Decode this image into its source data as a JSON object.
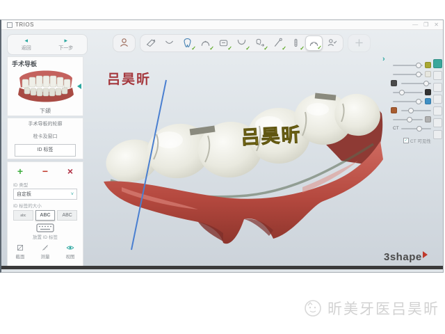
{
  "window": {
    "title": "TRIOS",
    "minimize": "—",
    "maximize": "❐",
    "close": "✕"
  },
  "nav": {
    "back_label": "返回",
    "next_label": "下一步",
    "back_arrow": "◂",
    "next_arrow": "▸"
  },
  "toolbar": {
    "check_glyph": "✓",
    "lead": [
      {
        "icon": "patient-icon",
        "checked": false,
        "active": false
      }
    ],
    "steps": [
      {
        "icon": "scan-icon",
        "checked": false,
        "active": false
      },
      {
        "icon": "smile-icon",
        "checked": false,
        "active": false
      },
      {
        "icon": "tooth-design-icon",
        "checked": true,
        "active": false
      },
      {
        "icon": "arch-icon",
        "checked": true,
        "active": false
      },
      {
        "icon": "model-icon",
        "checked": true,
        "active": false
      },
      {
        "icon": "u-arch-icon",
        "checked": true,
        "active": false
      },
      {
        "icon": "tooth-flow-icon",
        "checked": true,
        "active": false
      },
      {
        "icon": "probe-icon",
        "checked": true,
        "active": false
      },
      {
        "icon": "implant-icon",
        "checked": true,
        "active": false
      },
      {
        "icon": "guide-icon",
        "checked": true,
        "active": true
      },
      {
        "icon": "order-icon",
        "checked": false,
        "active": false
      }
    ],
    "trail": [
      {
        "icon": "export-icon",
        "checked": false,
        "active": false
      }
    ]
  },
  "sidebar": {
    "title": "手术导板",
    "jaw_label": "下颌",
    "menu_items": [
      {
        "label": "手术导板的轮廓",
        "selected": false
      },
      {
        "label": "栓卡及窗口",
        "selected": false
      },
      {
        "label": "ID 标签",
        "selected": true
      }
    ],
    "id_buttons": {
      "add": "+",
      "remove": "−",
      "close": "×"
    },
    "type_label": "ID 类型",
    "type_value": "自定板",
    "type_chevron": "˅",
    "size_label": "ID 标签的大小",
    "size_options": [
      {
        "label": "abc",
        "selected": false,
        "small": true
      },
      {
        "label": "ABC",
        "selected": true,
        "small": false
      },
      {
        "label": "ABC",
        "selected": false,
        "small": false
      }
    ],
    "stamp_label": "放置 ID 标签",
    "view_tools": [
      {
        "icon": "section-icon",
        "label": "截面"
      },
      {
        "icon": "measure-icon",
        "label": "测量"
      },
      {
        "icon": "eye-icon",
        "label": "视图"
      }
    ]
  },
  "viewport": {
    "annotation_red": "吕昊昕",
    "annotation_gold": "吕昊昕",
    "brand": "3shape",
    "colors": {
      "gum": "#b5493f",
      "tooth": "#ecece4",
      "axis_line": "#4a7fd0",
      "gold_text": "#d2bf2e",
      "red_text": "#a5383d"
    }
  },
  "right_panel": {
    "collapse_chevron": "›",
    "ct_checkbox_label": "CT 可见性",
    "ct_check_glyph": "✓",
    "sliders": [
      {
        "chip": "#a8a832",
        "right": true,
        "pos": "86%",
        "label": ""
      },
      {
        "chip": "#e6e6de",
        "right": true,
        "pos": "86%",
        "label": ""
      },
      {
        "chip": "#4a4a4a",
        "right": false,
        "pos": "84%",
        "label": ""
      },
      {
        "chip": "#333333",
        "right": true,
        "pos": "30%",
        "label": ""
      },
      {
        "chip": "#3f8fc4",
        "right": true,
        "pos": "86%",
        "label": ""
      },
      {
        "chip": "#a85c30",
        "right": false,
        "pos": "32%",
        "label": ""
      },
      {
        "chip": "#b0b0b0",
        "right": true,
        "pos": "55%",
        "label": ""
      },
      {
        "chip": null,
        "hidden_chip": true,
        "right": false,
        "pos": "60%",
        "label": "CT"
      }
    ],
    "view_icons": [
      {
        "active": true
      },
      {
        "active": false
      },
      {
        "active": false
      },
      {
        "active": false
      },
      {
        "active": false
      },
      {
        "active": false
      },
      {
        "active": false
      }
    ]
  },
  "watermark": {
    "text": "昕美牙医吕昊昕"
  }
}
